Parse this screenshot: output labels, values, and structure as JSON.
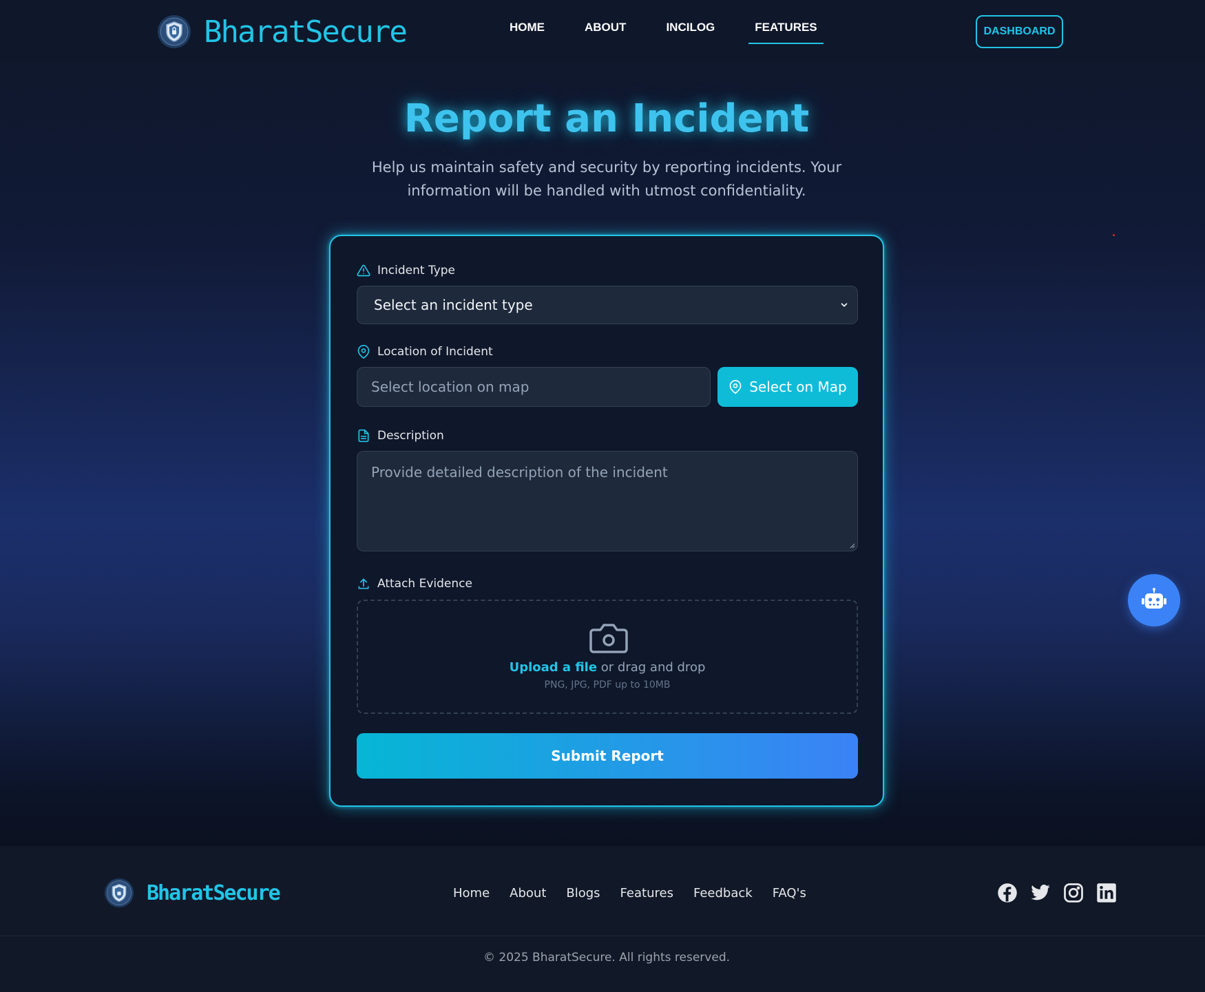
{
  "nav": {
    "brand": "BharatSecure",
    "links": [
      "HOME",
      "ABOUT",
      "INCILOG",
      "FEATURES"
    ],
    "active": "FEATURES",
    "dashboard_label": "DASHBOARD"
  },
  "hero": {
    "title": "Report an Incident",
    "subtitle": "Help us maintain safety and security by reporting incidents. Your information will be handled with utmost confidentiality."
  },
  "form": {
    "incident_type": {
      "label": "Incident Type",
      "selected": "Select an incident type"
    },
    "location": {
      "label": "Location of Incident",
      "placeholder": "Select location on map",
      "map_button": "Select on Map"
    },
    "description": {
      "label": "Description",
      "placeholder": "Provide detailed description of the incident"
    },
    "evidence": {
      "label": "Attach Evidence",
      "upload_link": "Upload a file",
      "upload_rest": " or drag and drop",
      "hint": "PNG, JPG, PDF up to 10MB"
    },
    "submit_label": "Submit Report"
  },
  "footer": {
    "brand": "BharatSecure",
    "links": [
      "Home",
      "About",
      "Blogs",
      "Features",
      "Feedback",
      "FAQ's"
    ],
    "social": [
      "facebook-icon",
      "twitter-icon",
      "instagram-icon",
      "linkedin-icon"
    ],
    "copyright": "© 2025 BharatSecure. All rights reserved."
  },
  "colors": {
    "accent": "#22c4e6",
    "primary_blue": "#3b82f6",
    "background": "#0f172a"
  }
}
